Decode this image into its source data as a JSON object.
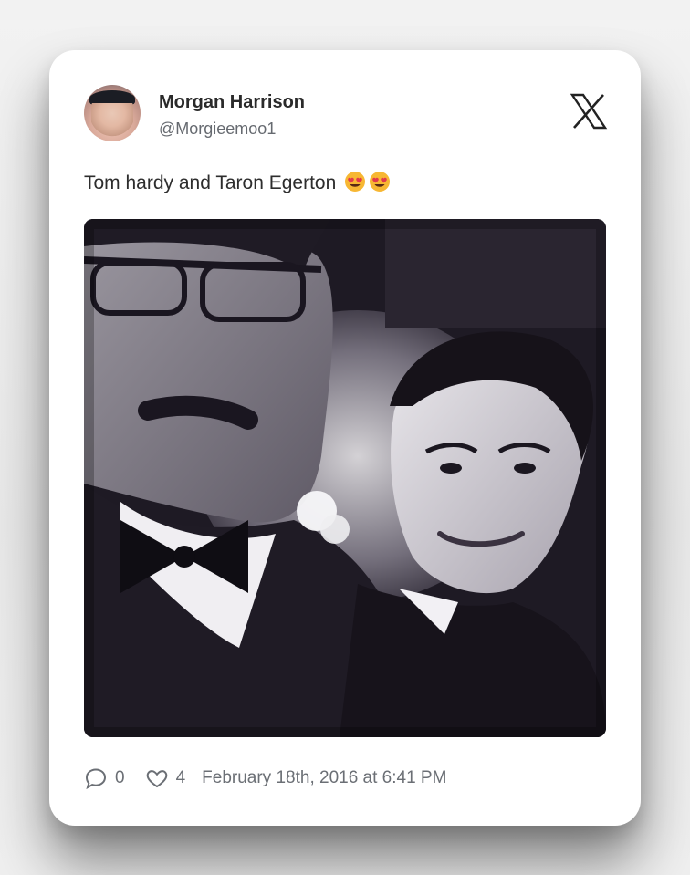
{
  "post": {
    "author_name": "Morgan Harrison",
    "author_handle": "@Morgieemoo1",
    "text": "Tom hardy and Taron Egerton",
    "emojis": [
      "heart-eyes-emoji",
      "heart-eyes-emoji"
    ],
    "replies_count": "0",
    "likes_count": "4",
    "timestamp": "February 18th, 2016 at 6:41 PM"
  },
  "icons": {
    "platform": "x-logo-icon",
    "reply": "speech-bubble-icon",
    "like": "heart-icon"
  },
  "image": {
    "description_tone": "black-and-white selfie photo",
    "tint": "#2b2633"
  }
}
